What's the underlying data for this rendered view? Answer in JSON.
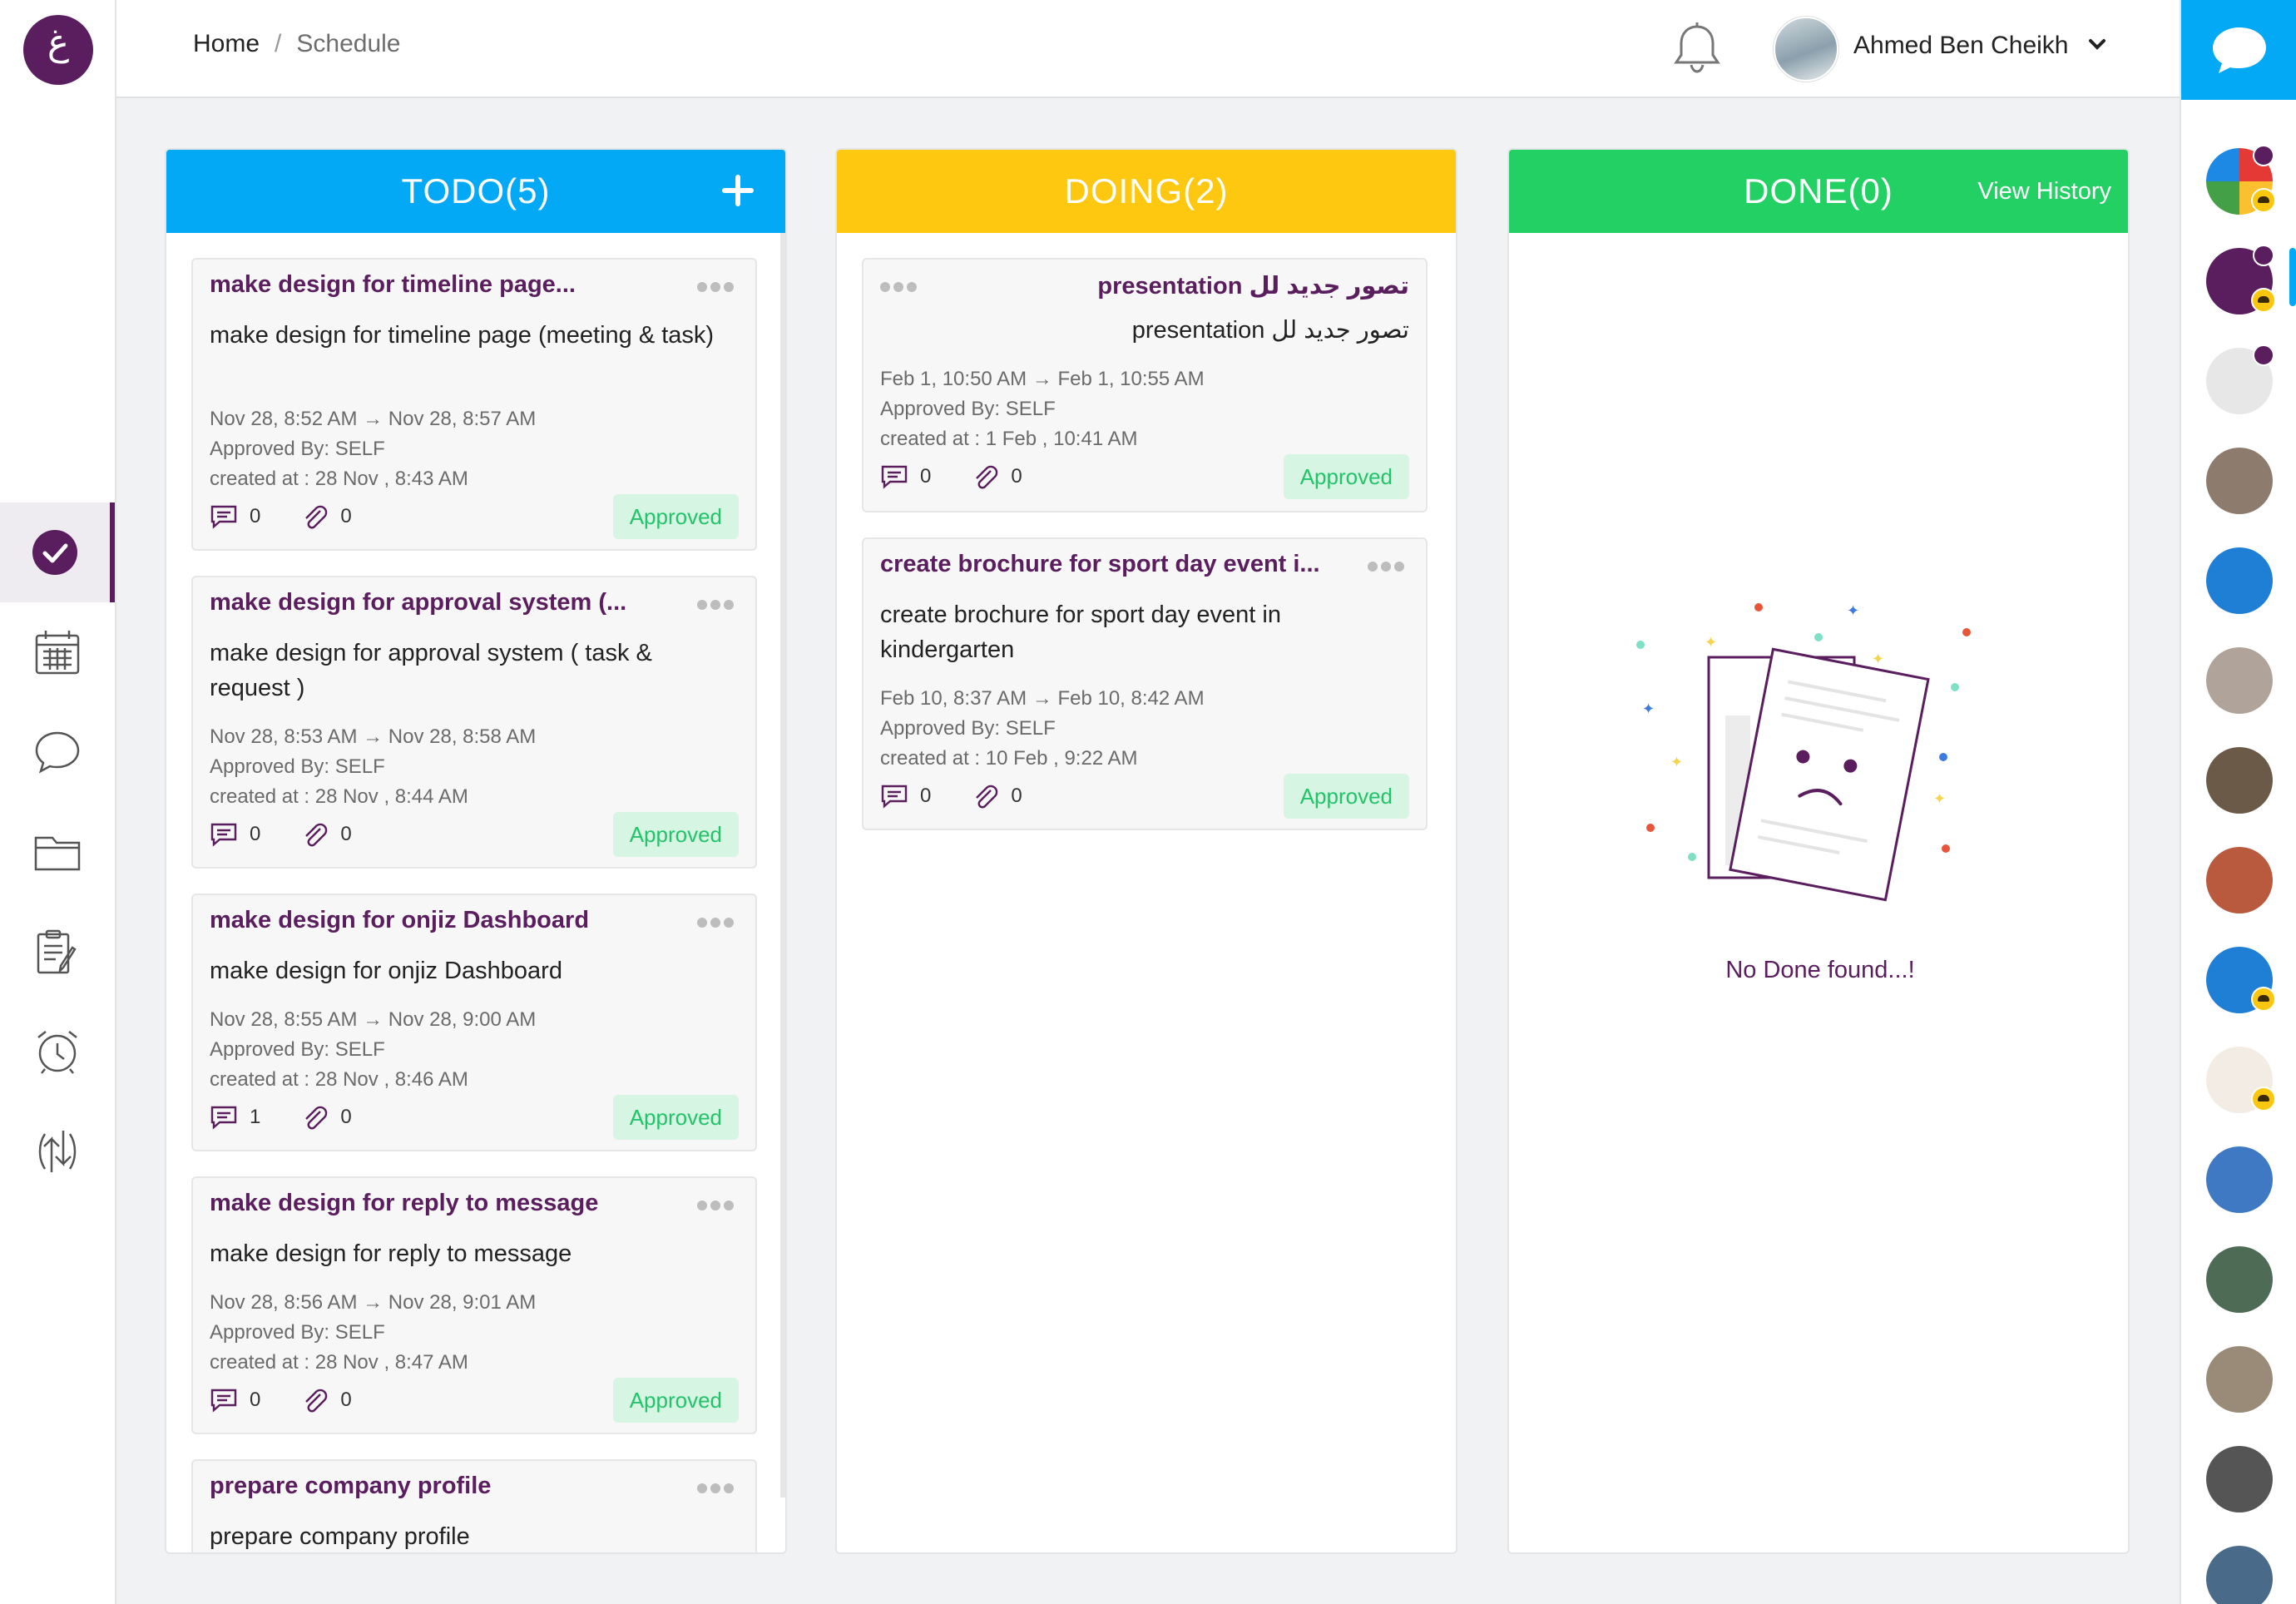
{
  "breadcrumb": {
    "home": "Home",
    "separator": "/",
    "current": "Schedule"
  },
  "user": {
    "name": "Ahmed Ben Cheikh"
  },
  "columns": {
    "todo": {
      "title": "TODO(5)"
    },
    "doing": {
      "title": "DOING(2)"
    },
    "done": {
      "title": "DONE(0)",
      "view_history": "View History",
      "empty_text": "No Done found...!"
    }
  },
  "todo_cards": [
    {
      "title": "make design for timeline page...",
      "description": "make design for timeline page (meeting & task)",
      "dates": "Nov 28, 8:52 AM  →  Nov 28, 8:57 AM",
      "approved_by": "Approved By: SELF",
      "created_at": "created at : 28 Nov , 8:43 AM",
      "comments": "0",
      "attachments": "0",
      "status": "Approved"
    },
    {
      "title": "make design for approval system (...",
      "description": "make design for approval system ( task & request )",
      "dates": "Nov 28, 8:53 AM  →  Nov 28, 8:58 AM",
      "approved_by": "Approved By: SELF",
      "created_at": "created at : 28 Nov , 8:44 AM",
      "comments": "0",
      "attachments": "0",
      "status": "Approved"
    },
    {
      "title": "make design for onjiz Dashboard",
      "description": "make design for onjiz Dashboard",
      "dates": "Nov 28, 8:55 AM  →  Nov 28, 9:00 AM",
      "approved_by": "Approved By: SELF",
      "created_at": "created at : 28 Nov , 8:46 AM",
      "comments": "1",
      "attachments": "0",
      "status": "Approved"
    },
    {
      "title": "make design for reply to message",
      "description": "make design for reply to message",
      "dates": "Nov 28, 8:56 AM  →  Nov 28, 9:01 AM",
      "approved_by": "Approved By: SELF",
      "created_at": "created at : 28 Nov , 8:47 AM",
      "comments": "0",
      "attachments": "0",
      "status": "Approved"
    },
    {
      "title": "prepare company profile",
      "description": "prepare company profile"
    }
  ],
  "doing_cards": [
    {
      "title": "تصور جديد لل presentation",
      "description": "تصور جديد لل presentation",
      "dates": "Feb 1, 10:50 AM  →  Feb 1, 10:55 AM",
      "approved_by": "Approved By: SELF",
      "created_at": "created at : 1 Feb , 10:41 AM",
      "comments": "0",
      "attachments": "0",
      "status": "Approved"
    },
    {
      "title": "create brochure for sport day event i...",
      "description": "create brochure for sport day event in kindergarten",
      "dates": "Feb 10, 8:37 AM  →  Feb 10, 8:42 AM",
      "approved_by": "Approved By: SELF",
      "created_at": "created at : 10 Feb , 9:22 AM",
      "comments": "0",
      "attachments": "0",
      "status": "Approved"
    }
  ],
  "colors": {
    "brand": "#5a1d5e",
    "todo": "#03a9f4",
    "doing": "#fec810",
    "done": "#23d064",
    "approved_bg": "#d6f5e3",
    "approved_text": "#23c36a"
  },
  "icons": {
    "sidebar": [
      "tasks-check-icon",
      "calendar-icon",
      "chat-bubble-icon",
      "folder-icon",
      "notes-edit-icon",
      "alarm-clock-icon",
      "sync-arrows-icon"
    ],
    "topbar": [
      "bell-icon",
      "chevron-down-icon"
    ],
    "rail": [
      "chat-icon"
    ]
  }
}
